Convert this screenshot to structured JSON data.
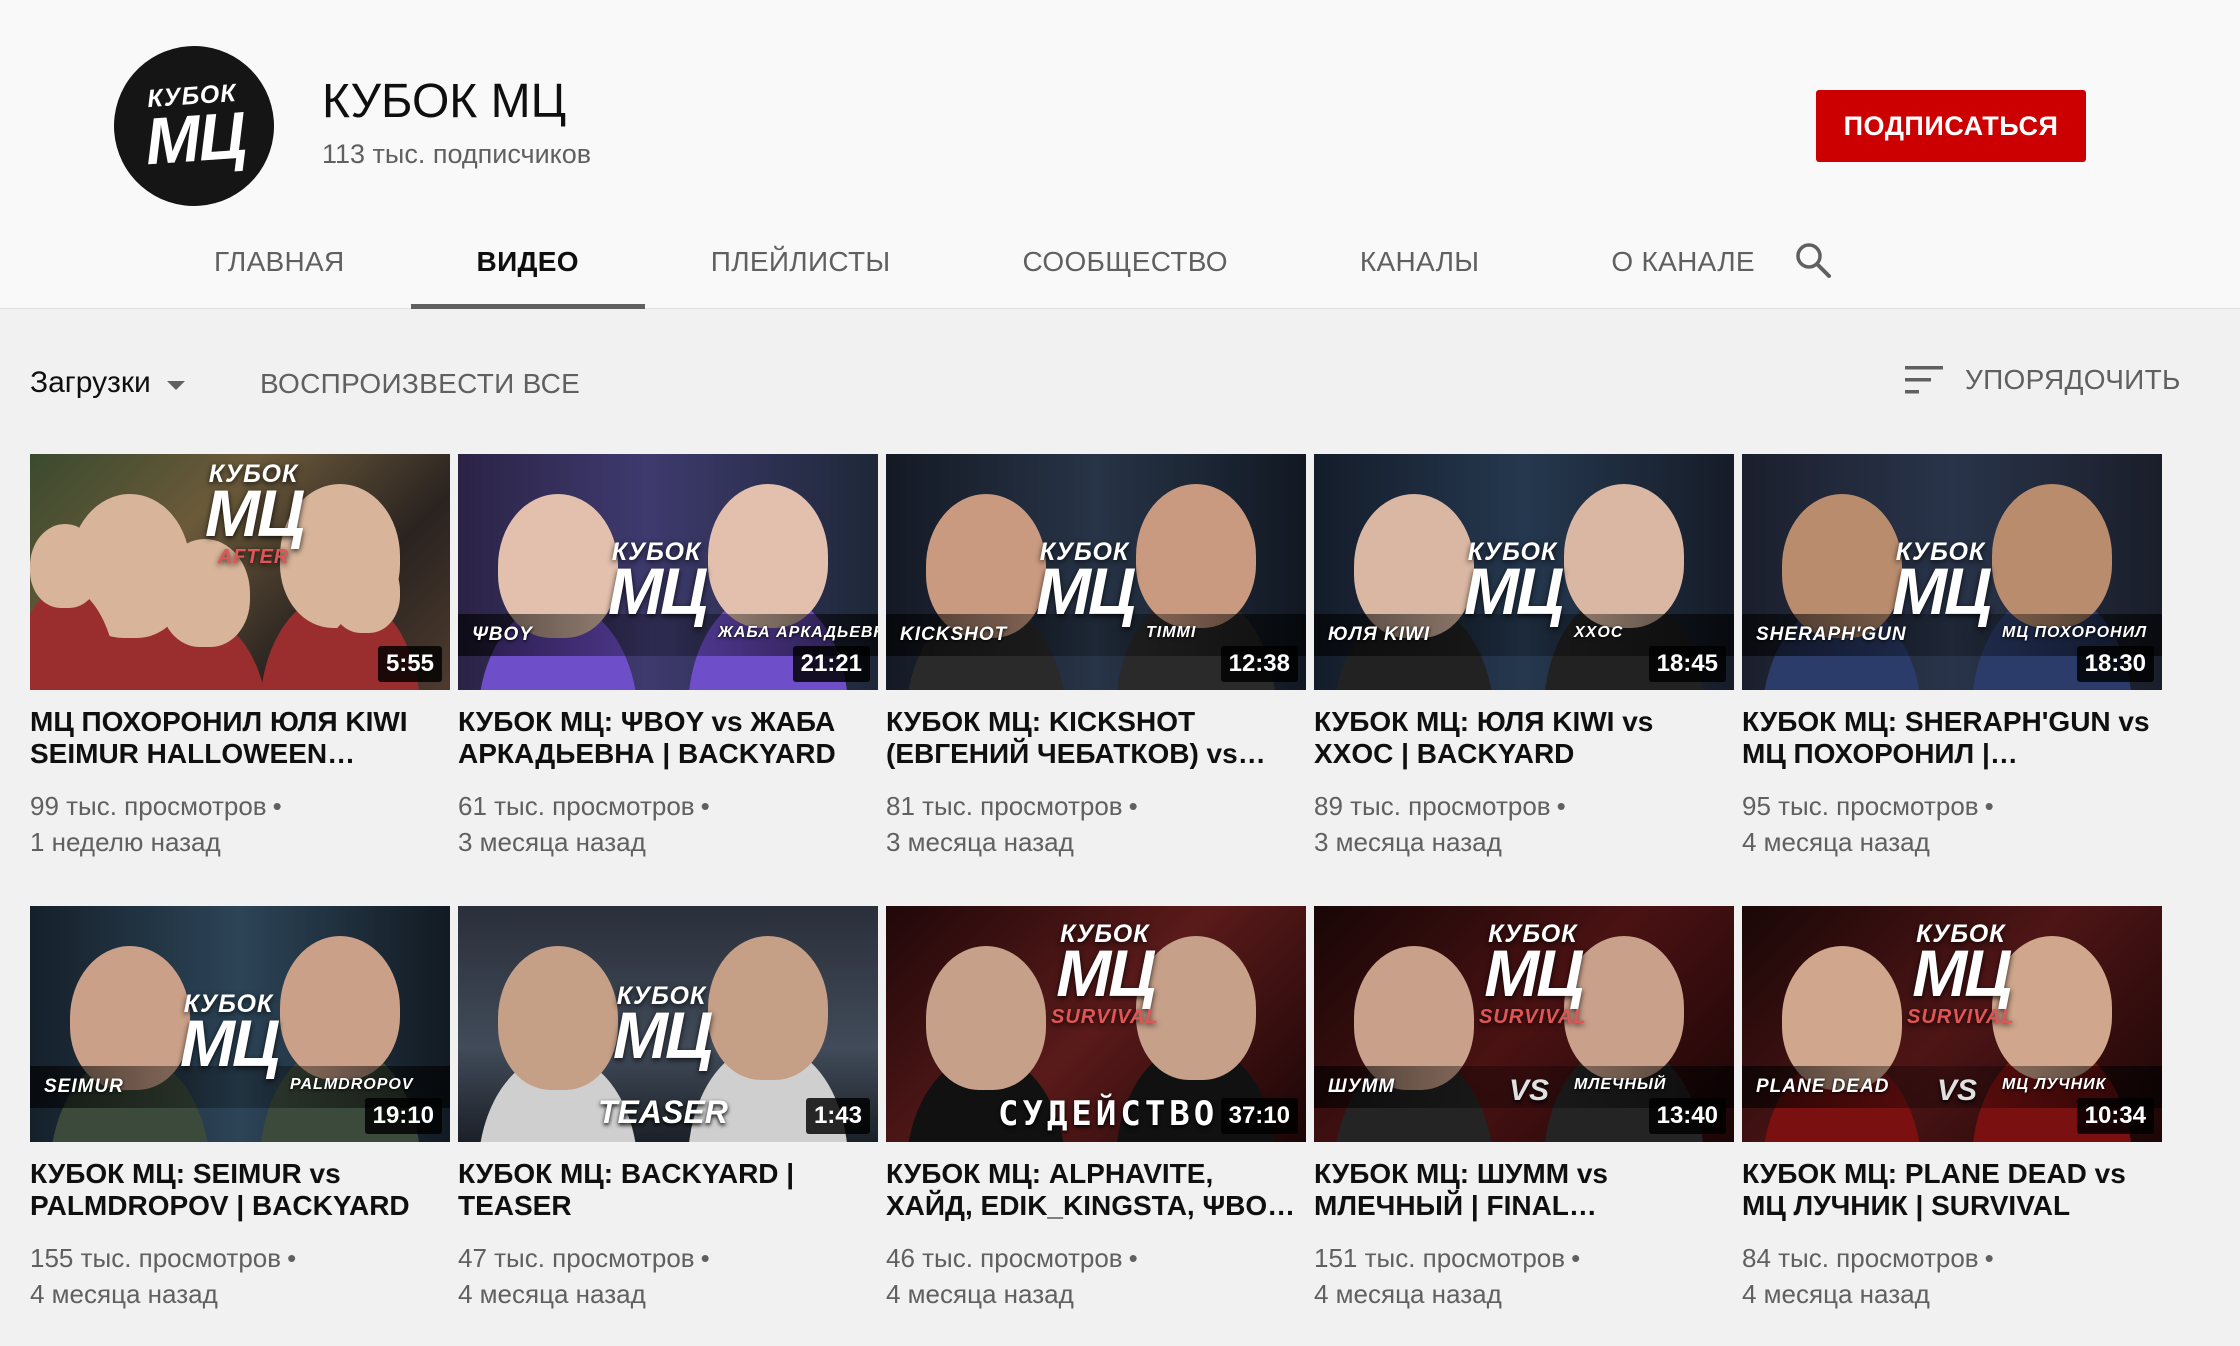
{
  "channel": {
    "name": "КУБОК МЦ",
    "subscribers": "113 тыс. подписчиков",
    "subscribe_label": "ПОДПИСАТЬСЯ",
    "avatar_text": [
      "КУБОК",
      "МЦ"
    ]
  },
  "tabs": [
    {
      "label": "ГЛАВНАЯ"
    },
    {
      "label": "ВИДЕО",
      "active": true
    },
    {
      "label": "ПЛЕЙЛИСТЫ"
    },
    {
      "label": "СООБЩЕСТВО"
    },
    {
      "label": "КАНАЛЫ"
    },
    {
      "label": "О КАНАЛЕ"
    }
  ],
  "toolbar": {
    "uploads_label": "Загрузки",
    "play_all_label": "ВОСПРОИЗВЕСТИ ВСЕ",
    "sort_label": "УПОРЯДОЧИТЬ"
  },
  "videos": [
    {
      "title": "МЦ ПОХОРОНИЛ ЮЛЯ KIWI SEIMUR HALLOWEEN…",
      "duration": "5:55",
      "views": "99 тыс. просмотров",
      "age": "1 неделю назад",
      "thumb": {
        "logo_small": "КУБОК",
        "logo_big": "МЦ",
        "logo_sub": "AFTER",
        "left_name": "",
        "right_name": "",
        "bottom_big": ""
      }
    },
    {
      "title": "КУБОК МЦ: ΨBOY vs ЖАБА АРКАДЬЕВНА | BACKYARD",
      "duration": "21:21",
      "views": "61 тыс. просмотров",
      "age": "3 месяца назад",
      "thumb": {
        "logo_small": "КУБОК",
        "logo_big": "МЦ",
        "logo_sub": "",
        "left_name": "ΨBOY",
        "right_name": "ЖАБА АРКАДЬЕВНА",
        "bottom_big": ""
      }
    },
    {
      "title": "КУБОК МЦ: KICKSHOT (ЕВГЕНИЙ ЧЕБАТКОВ) vs…",
      "duration": "12:38",
      "views": "81 тыс. просмотров",
      "age": "3 месяца назад",
      "thumb": {
        "logo_small": "КУБОК",
        "logo_big": "МЦ",
        "logo_sub": "",
        "left_name": "KICKSHOT",
        "right_name": "TIMMI",
        "bottom_big": ""
      }
    },
    {
      "title": "КУБОК МЦ: ЮЛЯ KIWI vs XXOC | BACKYARD",
      "duration": "18:45",
      "views": "89 тыс. просмотров",
      "age": "3 месяца назад",
      "thumb": {
        "logo_small": "КУБОК",
        "logo_big": "МЦ",
        "logo_sub": "",
        "left_name": "ЮЛЯ KIWI",
        "right_name": "XXOC",
        "bottom_big": ""
      }
    },
    {
      "title": "КУБОК МЦ: SHERAPH'GUN vs МЦ ПОХОРОНИЛ |…",
      "duration": "18:30",
      "views": "95 тыс. просмотров",
      "age": "4 месяца назад",
      "thumb": {
        "logo_small": "КУБОК",
        "logo_big": "МЦ",
        "logo_sub": "",
        "left_name": "SHERAPH'GUN",
        "right_name": "МЦ ПОХОРОНИЛ",
        "bottom_big": ""
      }
    },
    {
      "title": "КУБОК МЦ: SEIMUR vs PALMDROPOV | BACKYARD",
      "duration": "19:10",
      "views": "155 тыс. просмотров",
      "age": "4 месяца назад",
      "thumb": {
        "logo_small": "КУБОК",
        "logo_big": "МЦ",
        "logo_sub": "",
        "left_name": "SEIMUR",
        "right_name": "PALMDROPOV",
        "bottom_big": ""
      }
    },
    {
      "title": "КУБОК МЦ: BACKYARD | TEASER",
      "duration": "1:43",
      "views": "47 тыс. просмотров",
      "age": "4 месяца назад",
      "thumb": {
        "logo_small": "КУБОК",
        "logo_big": "МЦ",
        "logo_sub": "",
        "left_name": "",
        "right_name": "",
        "bottom_big": "TEASER"
      }
    },
    {
      "title": "КУБОК МЦ: ALPHAVITE, ХАЙД, EDIK_KINGSTA, ΨBO…",
      "duration": "37:10",
      "views": "46 тыс. просмотров",
      "age": "4 месяца назад",
      "thumb": {
        "logo_small": "КУБОК",
        "logo_big": "МЦ",
        "logo_sub": "SURVIVAL",
        "left_name": "",
        "right_name": "",
        "bottom_big": "СУДЕЙСТВО"
      }
    },
    {
      "title": "КУБОК МЦ: ШУММ vs МЛЕЧНЫЙ | FINAL…",
      "duration": "13:40",
      "views": "151 тыс. просмотров",
      "age": "4 месяца назад",
      "thumb": {
        "logo_small": "КУБОК",
        "logo_big": "МЦ",
        "logo_sub": "SURVIVAL",
        "left_name": "ШУММ",
        "right_name": "МЛЕЧНЫЙ",
        "bottom_big": "VS"
      }
    },
    {
      "title": "КУБОК МЦ: PLANE DEAD vs МЦ ЛУЧНИК | SURVIVAL",
      "duration": "10:34",
      "views": "84 тыс. просмотров",
      "age": "4 месяца назад",
      "thumb": {
        "logo_small": "КУБОК",
        "logo_big": "МЦ",
        "logo_sub": "SURVIVAL",
        "left_name": "PLANE DEAD",
        "right_name": "МЦ ЛУЧНИК",
        "bottom_big": "VS"
      }
    }
  ],
  "colors": {
    "subscribe": "#cc0000",
    "page_bg": "#f1f1f1",
    "header_bg": "#f9f9f9",
    "text_primary": "#0f0f0f",
    "text_secondary": "#606060"
  },
  "icons": {
    "search": "search-icon",
    "sort": "sort-icon",
    "dropdown": "caret-down-icon"
  }
}
